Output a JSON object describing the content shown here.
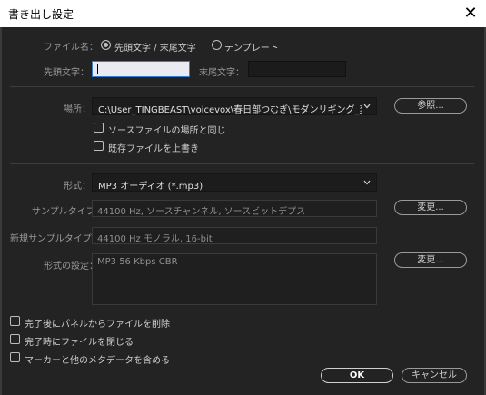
{
  "window": {
    "title": "書き出し設定",
    "close_icon": "close-icon"
  },
  "filename": {
    "label": "ファイル名：",
    "option_prefix_suffix": "先頭文字 / 末尾文字",
    "option_template": "テンプレート",
    "selected": "先頭文字 / 末尾文字",
    "prefix_label": "先頭文字：",
    "prefix_value": "",
    "suffix_label": "末尾文字：",
    "suffix_value": ""
  },
  "location": {
    "label": "場所：",
    "path": "C:\\User_TINGBEAST\\voicevox\\春日部つむぎ\\モダンリギング_変換",
    "browse_button": "参照...",
    "same_as_source": "ソースファイルの場所と同じ",
    "same_as_source_checked": false,
    "overwrite": "既存ファイルを上書き",
    "overwrite_checked": false
  },
  "format": {
    "label": "形式：",
    "value": "MP3 オーディオ (*.mp3)",
    "sample_type_label": "サンプルタイプ：",
    "sample_type_value": "44100 Hz, ソースチャンネル, ソースビットデプス",
    "sample_type_button": "変更...",
    "new_sample_type_label": "新規サンプルタイプ：",
    "new_sample_type_value": "44100 Hz モノラル, 16-bit",
    "settings_label": "形式の設定：",
    "settings_value": "MP3 56 Kbps CBR",
    "settings_button": "変更..."
  },
  "options": [
    {
      "label": "完了後にパネルからファイルを削除",
      "checked": false
    },
    {
      "label": "完了時にファイルを閉じる",
      "checked": false
    },
    {
      "label": "マーカーと他のメタデータを含める",
      "checked": false
    }
  ],
  "footer": {
    "ok": "OK",
    "cancel": "キャンセル"
  }
}
